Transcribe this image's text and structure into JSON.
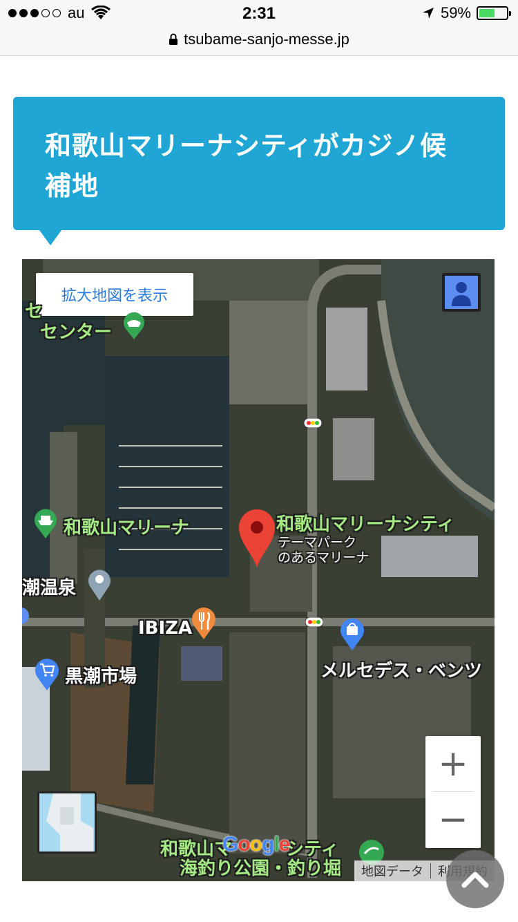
{
  "status_bar": {
    "carrier": "au",
    "time": "2:31",
    "battery_percent": "59%",
    "battery_level": 0.59,
    "signal_bars_filled": 3,
    "signal_bars_total": 5
  },
  "browser": {
    "url": "tsubame-sanjo-messe.jp"
  },
  "heading": {
    "title": "和歌山マリーナシティがカジノ候補地",
    "color": "#1fa6d5"
  },
  "map": {
    "enlarge_label": "拡大地図を表示",
    "labels": {
      "center_top_line1": "セ",
      "center_top_line2": "センター",
      "marina": "和歌山マリーナ",
      "marina_city": "和歌山マリーナシティ",
      "marina_city_sub1": "テーマパーク",
      "marina_city_sub2": "のあるマリーナ",
      "onsen": "潮温泉",
      "ibiza": "IBIZA",
      "kuroshio": "黒潮市場",
      "mercedes": "メルセデス・ベンツ",
      "fishing_line1": "和歌山マ",
      "fishing_line1b": "シティ",
      "fishing_line2": "海釣り公園・釣り堀"
    },
    "zoom_in_label": "+",
    "zoom_out_label": "−",
    "google_logo": "Google",
    "attribution_data": "地図データ",
    "attribution_terms": "利用規約"
  },
  "back_to_top_icon": "chevron-up-icon"
}
